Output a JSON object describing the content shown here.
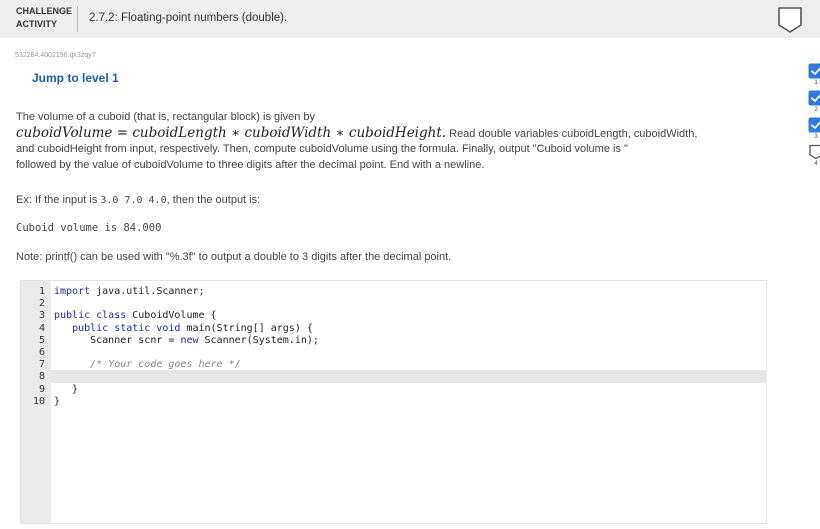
{
  "header": {
    "label_line1": "CHALLENGE",
    "label_line2": "ACTIVITY",
    "title": "2.7.2: Floating-point numbers (double)."
  },
  "code_id": "532284.4002196.qx3zqy7",
  "jump_label": "Jump to level 1",
  "prompt": {
    "intro": "The volume of a cuboid (that is, rectangular block) is given by",
    "formula": "cuboidVolume = cuboidLength ∗ cuboidWidth ∗ cuboidHeight.",
    "instructions_a": " Read double variables cuboidLength, cuboidWidth,",
    "instructions_b": "and cuboidHeight from input, respectively. Then, compute cuboidVolume using the formula. Finally, output \"Cuboid volume is \"",
    "instructions_c": "followed by the value of cuboidVolume to three digits after the decimal point. End with a newline.",
    "example_prefix": "Ex: If the input is ",
    "example_input": "3.0 7.0 4.0",
    "example_suffix": ", then the output is:",
    "sample_output": "Cuboid volume is 84.000",
    "note": "Note: printf() can be used with \"%.3f\" to output a double to 3 digits after the decimal point."
  },
  "editor": {
    "lines": [
      {
        "n": "1",
        "pre": "",
        "kw": "import",
        "rest": " java.util.Scanner;"
      },
      {
        "n": "2",
        "pre": "",
        "kw": "",
        "rest": ""
      },
      {
        "n": "3",
        "pre": "",
        "kw": "public class",
        "rest": " CuboidVolume {"
      },
      {
        "n": "4",
        "pre": "   ",
        "kw": "public static void",
        "rest": " main(String[] args) {"
      },
      {
        "n": "5",
        "pre": "      Scanner scnr = ",
        "kw": "new",
        "rest": " Scanner(System.in);"
      },
      {
        "n": "6",
        "pre": "",
        "kw": "",
        "rest": ""
      },
      {
        "n": "7",
        "pre": "      ",
        "kw": "",
        "rest": "",
        "comment": "/* Your code goes here */"
      },
      {
        "n": "8",
        "pre": "",
        "kw": "",
        "rest": ""
      },
      {
        "n": "9",
        "pre": "   }",
        "kw": "",
        "rest": ""
      },
      {
        "n": "10",
        "pre": "}",
        "kw": "",
        "rest": ""
      }
    ]
  },
  "levels": [
    {
      "num": "1",
      "done": true
    },
    {
      "num": "2",
      "done": true
    },
    {
      "num": "3",
      "done": true
    },
    {
      "num": "4",
      "done": false
    }
  ],
  "colors": {
    "accent": "#1a5fb4",
    "level_done": "#2b7be0",
    "header_bg": "#eeeeee"
  }
}
